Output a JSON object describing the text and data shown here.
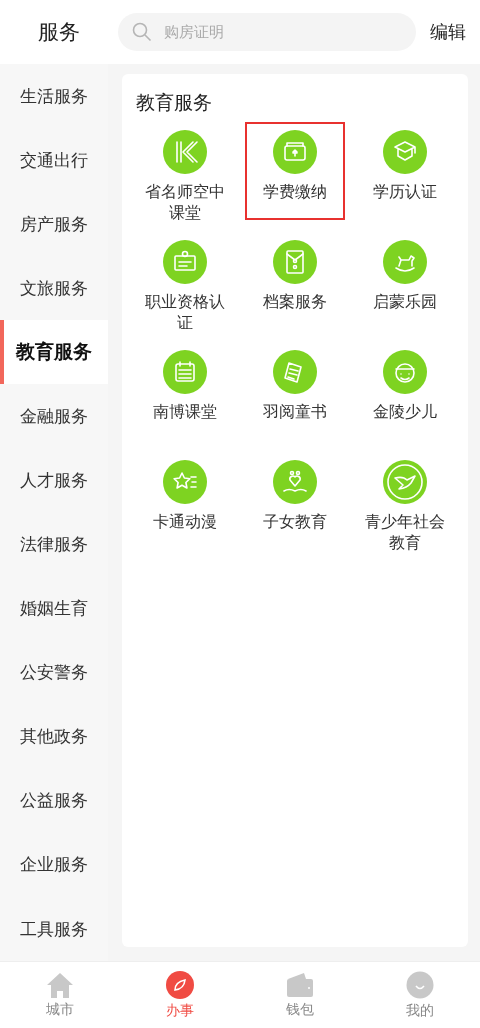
{
  "header": {
    "title": "服务",
    "search": {
      "placeholder": "购房证明"
    },
    "edit": "编辑"
  },
  "sidebar": {
    "items": [
      {
        "label": "生活服务",
        "selected": false
      },
      {
        "label": "交通出行",
        "selected": false
      },
      {
        "label": "房产服务",
        "selected": false
      },
      {
        "label": "文旅服务",
        "selected": false
      },
      {
        "label": "教育服务",
        "selected": true
      },
      {
        "label": "金融服务",
        "selected": false
      },
      {
        "label": "人才服务",
        "selected": false
      },
      {
        "label": "法律服务",
        "selected": false
      },
      {
        "label": "婚姻生育",
        "selected": false
      },
      {
        "label": "公安警务",
        "selected": false
      },
      {
        "label": "其他政务",
        "selected": false
      },
      {
        "label": "公益服务",
        "selected": false
      },
      {
        "label": "企业服务",
        "selected": false
      },
      {
        "label": "工具服务",
        "selected": false
      }
    ]
  },
  "section": {
    "title": "教育服务",
    "services": [
      {
        "label": "省名师空中课堂",
        "highlighted": false
      },
      {
        "label": "学费缴纳",
        "highlighted": true
      },
      {
        "label": "学历认证",
        "highlighted": false
      },
      {
        "label": "职业资格认证",
        "highlighted": false
      },
      {
        "label": "档案服务",
        "highlighted": false
      },
      {
        "label": "启蒙乐园",
        "highlighted": false
      },
      {
        "label": "南博课堂",
        "highlighted": false
      },
      {
        "label": "羽阅童书",
        "highlighted": false
      },
      {
        "label": "金陵少儿",
        "highlighted": false
      },
      {
        "label": "卡通动漫",
        "highlighted": false
      },
      {
        "label": "子女教育",
        "highlighted": false
      },
      {
        "label": "青少年社会教育",
        "highlighted": false
      }
    ]
  },
  "tab_bar": [
    {
      "label": "城市",
      "selected": false
    },
    {
      "label": "办事",
      "selected": true
    },
    {
      "label": "钱包",
      "selected": false
    },
    {
      "label": "我的",
      "selected": false
    }
  ]
}
